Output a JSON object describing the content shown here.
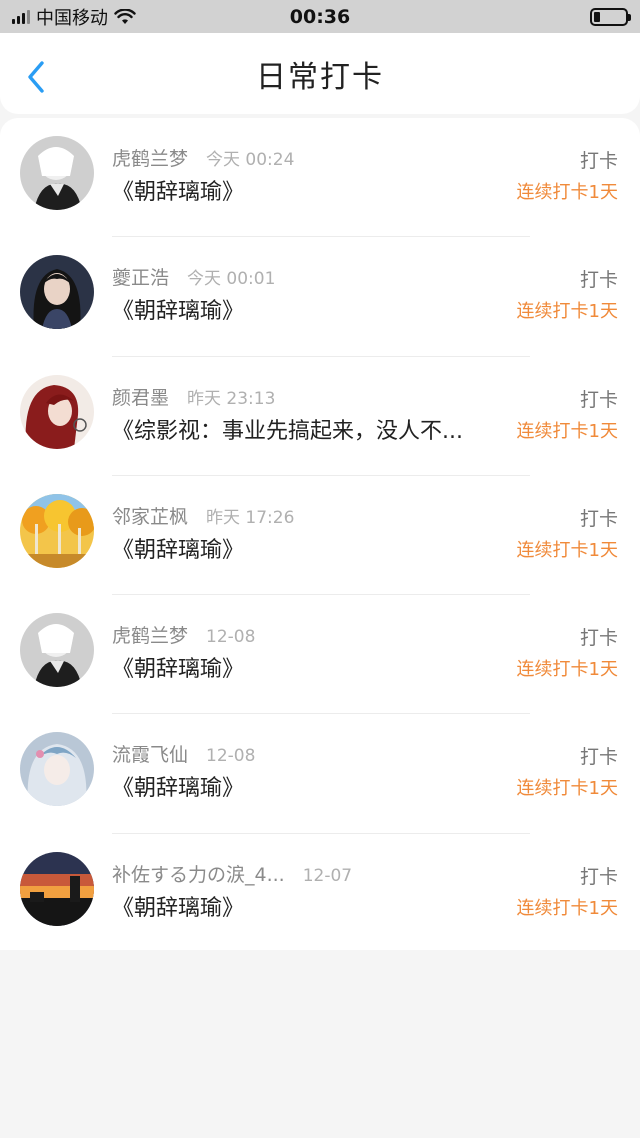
{
  "status_bar": {
    "carrier": "中国移动",
    "time": "00:36"
  },
  "header": {
    "title": "日常打卡"
  },
  "checkins": [
    {
      "name": "虎鹤兰梦",
      "time": "今天 00:24",
      "book": "《朝辞璃瑜》",
      "action": "打卡",
      "streak": "连续打卡1天",
      "avatar": "white-haired-figure"
    },
    {
      "name": "夔正浩",
      "time": "今天 00:01",
      "book": "《朝辞璃瑜》",
      "action": "打卡",
      "streak": "连续打卡1天",
      "avatar": "dark-haired-girl"
    },
    {
      "name": "颜君墨",
      "time": "昨天 23:13",
      "book": "《综影视：事业先搞起来，没人不...",
      "action": "打卡",
      "streak": "连续打卡1天",
      "avatar": "red-haired-girl"
    },
    {
      "name": "邻家芷枫",
      "time": "昨天 17:26",
      "book": "《朝辞璃瑜》",
      "action": "打卡",
      "streak": "连续打卡1天",
      "avatar": "autumn-trees"
    },
    {
      "name": "虎鹤兰梦",
      "time": "12-08",
      "book": "《朝辞璃瑜》",
      "action": "打卡",
      "streak": "连续打卡1天",
      "avatar": "white-haired-figure"
    },
    {
      "name": "流霞飞仙",
      "time": "12-08",
      "book": "《朝辞璃瑜》",
      "action": "打卡",
      "streak": "连续打卡1天",
      "avatar": "pale-blue-girl"
    },
    {
      "name": "补佐する力の涙_4...",
      "time": "12-07",
      "book": "《朝辞璃瑜》",
      "action": "打卡",
      "streak": "连续打卡1天",
      "avatar": "sunset-sky"
    }
  ],
  "colors": {
    "accent_blue": "#2a9df4",
    "streak_orange": "#f08a3a"
  }
}
